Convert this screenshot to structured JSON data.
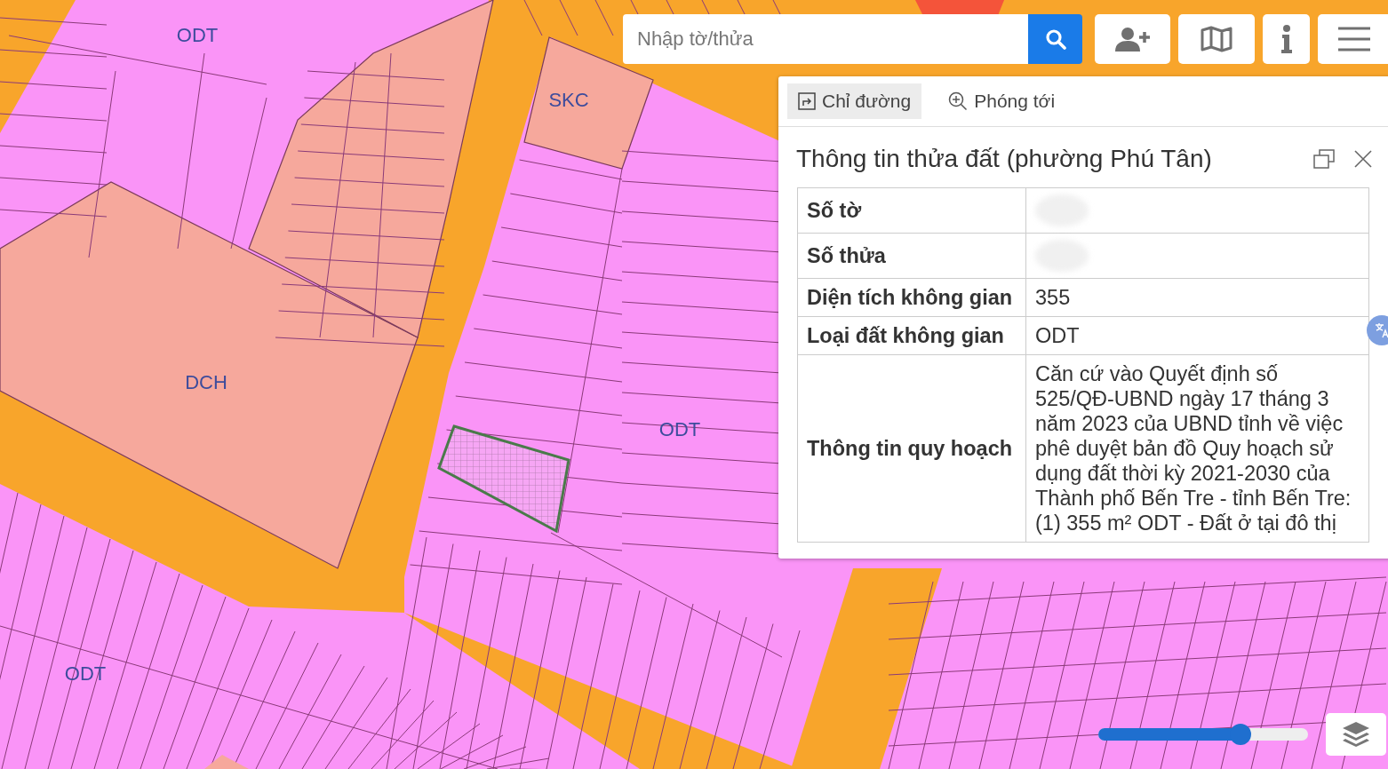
{
  "search": {
    "placeholder": "Nhập tờ/thửa"
  },
  "map": {
    "labels": [
      {
        "text": "ODT"
      },
      {
        "text": "SKC"
      },
      {
        "text": "DCH"
      },
      {
        "text": "ODT"
      },
      {
        "text": "ODT"
      }
    ]
  },
  "popup": {
    "actions": [
      {
        "kind": "directions",
        "label": "Chỉ đường",
        "selected": true
      },
      {
        "kind": "zoom",
        "label": "Phóng tới",
        "selected": false
      }
    ],
    "title": "Thông tin thửa đất (phường Phú Tân)",
    "rows": [
      {
        "label": "Số tờ",
        "redacted": true
      },
      {
        "label": "Số thửa",
        "redacted": true
      },
      {
        "label": "Diện tích không gian",
        "value": "355"
      },
      {
        "label": "Loại đất không gian",
        "value": "ODT"
      },
      {
        "label": "Thông tin quy hoạch",
        "value": "Căn cứ vào Quyết định số 525/QĐ-UBND ngày 17 tháng 3 năm 2023 của UBND tỉnh về việc phê duyệt bản đồ Quy hoạch sử dụng đất thời kỳ 2021-2030 của Thành phố Bến Tre - tỉnh Bến Tre: (1) 355 m² ODT - Đất ở tại đô thị"
      }
    ]
  },
  "zoom_slider": {
    "level": 0.68
  }
}
